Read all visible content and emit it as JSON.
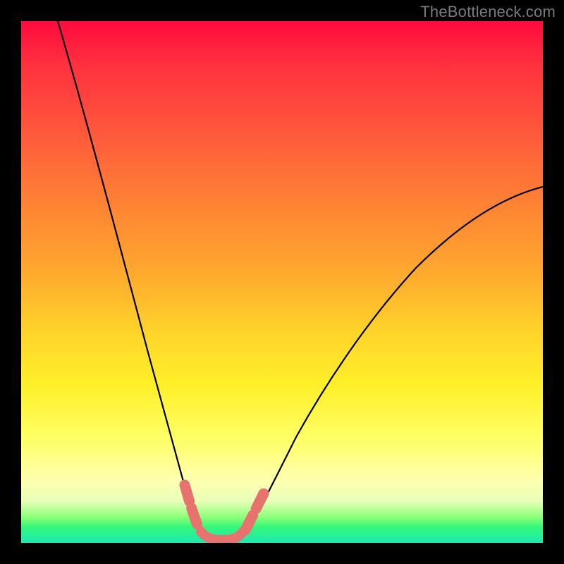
{
  "watermark": "TheBottleneck.com",
  "chart_data": {
    "type": "line",
    "title": "",
    "xlabel": "",
    "ylabel": "",
    "xlim": [
      0,
      100
    ],
    "ylim": [
      0,
      100
    ],
    "grid": false,
    "series": [
      {
        "name": "bottleneck-curve",
        "x": [
          0,
          5,
          10,
          15,
          20,
          25,
          28,
          30,
          32,
          34,
          36,
          38,
          40,
          45,
          50,
          55,
          60,
          65,
          70,
          75,
          80,
          85,
          90,
          95,
          100
        ],
        "values": [
          100,
          88,
          76,
          64,
          52,
          38,
          25,
          14,
          6,
          1,
          0,
          0,
          0,
          2,
          6,
          12,
          18,
          25,
          32,
          39,
          46,
          52,
          58,
          63,
          67
        ]
      }
    ],
    "highlight_segments": [
      {
        "name": "left-worm",
        "x_start": 29,
        "x_end": 32
      },
      {
        "name": "right-worm",
        "x_start": 40,
        "x_end": 43
      },
      {
        "name": "valley-floor",
        "x_start": 32,
        "x_end": 40
      }
    ],
    "gradient_stops": [
      {
        "pos": 0,
        "color": "#ff0a3e"
      },
      {
        "pos": 60,
        "color": "#ffd52a"
      },
      {
        "pos": 88,
        "color": "#ffffb0"
      },
      {
        "pos": 97,
        "color": "#34f77a"
      },
      {
        "pos": 100,
        "color": "#1de9b6"
      }
    ]
  }
}
